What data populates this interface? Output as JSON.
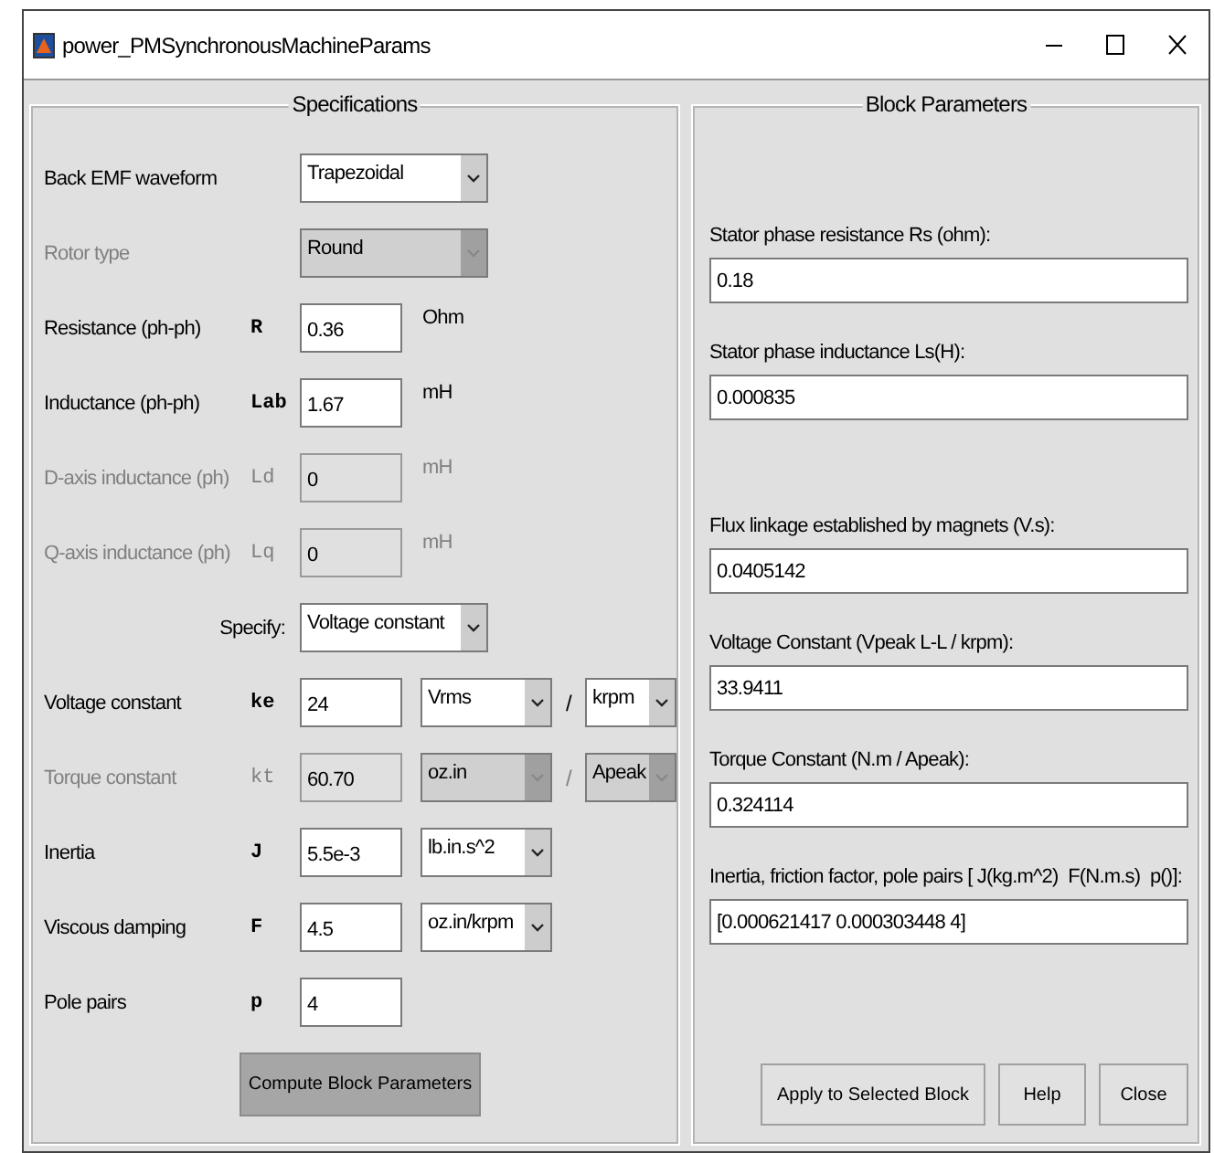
{
  "window": {
    "title": "power_PMSynchronousMachineParams"
  },
  "specifications": {
    "title": "Specifications",
    "rows": [
      {
        "kind": "popup",
        "label": "Back EMF waveform",
        "value": "Trapezoidal",
        "disabled": false
      },
      {
        "kind": "popup",
        "label": "Rotor type",
        "value": "Round",
        "disabled": true
      },
      {
        "kind": "param",
        "label": "Resistance (ph-ph)",
        "symbol": "R",
        "value": "0.36",
        "unit": "Ohm",
        "disabled": false
      },
      {
        "kind": "param",
        "label": "Inductance (ph-ph)",
        "symbol": "Lab",
        "value": "1.67",
        "unit": "mH",
        "disabled": false
      },
      {
        "kind": "param",
        "label": "D-axis inductance (ph)",
        "symbol": "Ld",
        "value": "0",
        "unit": "mH",
        "disabled": true
      },
      {
        "kind": "param",
        "label": "Q-axis inductance (ph)",
        "symbol": "Lq",
        "value": "0",
        "unit": "mH",
        "disabled": true
      },
      {
        "kind": "specify",
        "label": "Specify:",
        "value": "Voltage constant",
        "disabled": false
      },
      {
        "kind": "param",
        "label": "Voltage constant",
        "symbol": "ke",
        "value": "24",
        "units": [
          "Vrms",
          "krpm"
        ],
        "separator": "/",
        "disabled": false
      },
      {
        "kind": "param",
        "label": "Torque constant",
        "symbol": "kt",
        "value": "60.70",
        "units": [
          "oz.in",
          "Apeak"
        ],
        "separator": "/",
        "disabled": true
      },
      {
        "kind": "param",
        "label": "Inertia",
        "symbol": "J",
        "value": "5.5e-3",
        "units": [
          "lb.in.s^2"
        ],
        "disabled": false
      },
      {
        "kind": "param",
        "label": "Viscous damping",
        "symbol": "F",
        "value": "4.5",
        "units": [
          "oz.in/krpm"
        ],
        "disabled": false
      },
      {
        "kind": "param",
        "label": "Pole pairs",
        "symbol": "p",
        "value": "4",
        "disabled": false
      }
    ],
    "button": "Compute Block Parameters"
  },
  "block_parameters": {
    "title": "Block Parameters",
    "fields": [
      {
        "label": "Stator phase resistance Rs (ohm):",
        "value": "0.18",
        "spaced": false
      },
      {
        "label": "Stator phase inductance Ls(H):",
        "value": "0.000835",
        "spaced": false
      },
      {
        "label": "Flux linkage established by magnets (V.s):",
        "value": "0.0405142",
        "spaced": true
      },
      {
        "label": "Voltage Constant (Vpeak L-L / krpm):",
        "value": "33.9411",
        "spaced": false
      },
      {
        "label": "Torque Constant (N.m / Apeak):",
        "value": "0.324114",
        "spaced": false
      },
      {
        "label": "Inertia, friction factor, pole pairs [ J(kg.m^2)  F(N.m.s)  p()]:",
        "value": "[0.000621417 0.000303448 4]",
        "spaced": false
      }
    ],
    "buttons": [
      "Apply to Selected Block",
      "Help",
      "Close"
    ]
  }
}
